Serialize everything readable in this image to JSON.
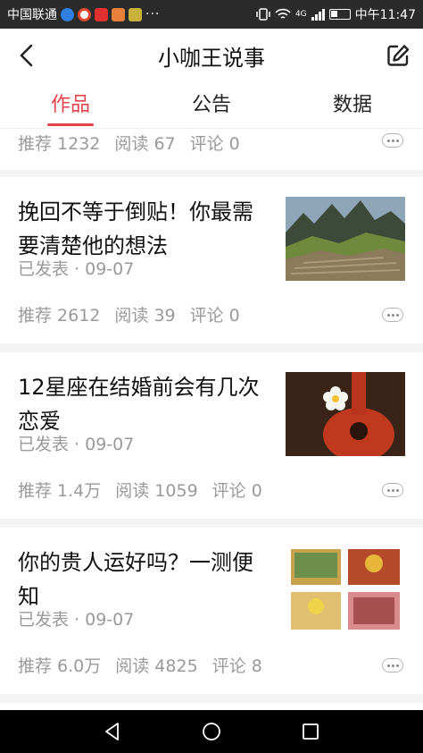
{
  "status_bar": {
    "carrier": "中国联通",
    "time": "中午11:47",
    "network": "4G"
  },
  "header": {
    "title": "小咖王说事",
    "back_icon": "chevron-left-icon",
    "edit_icon": "edit-icon"
  },
  "tabs": [
    {
      "label": "作品",
      "active": true
    },
    {
      "label": "公告",
      "active": false
    },
    {
      "label": "数据",
      "active": false
    }
  ],
  "partial_item": {
    "recommend": "推荐 1232",
    "reads": "阅读 67",
    "comments": "评论 0"
  },
  "articles": [
    {
      "title": "挽回不等于倒贴！你最需要清楚他的想法",
      "meta": "已发表 · 09-07",
      "recommend": "推荐 2612",
      "reads": "阅读 39",
      "comments": "评论 0",
      "thumb": "mountain-ruins-photo"
    },
    {
      "title": "12星座在结婚前会有几次恋爱",
      "meta": "已发表 · 09-07",
      "recommend": "推荐 1.4万",
      "reads": "阅读 1059",
      "comments": "评论 0",
      "thumb": "ukulele-flower-photo"
    },
    {
      "title": "你的贵人运好吗？一测便知",
      "meta": "已发表 · 09-07",
      "recommend": "推荐 6.0万",
      "reads": "阅读 4825",
      "comments": "评论 8",
      "thumb": "tarot-cards-collage"
    }
  ],
  "colors": {
    "accent": "#e5434b",
    "muted_text": "#9a9a9a",
    "divider": "#f4f4f4"
  }
}
